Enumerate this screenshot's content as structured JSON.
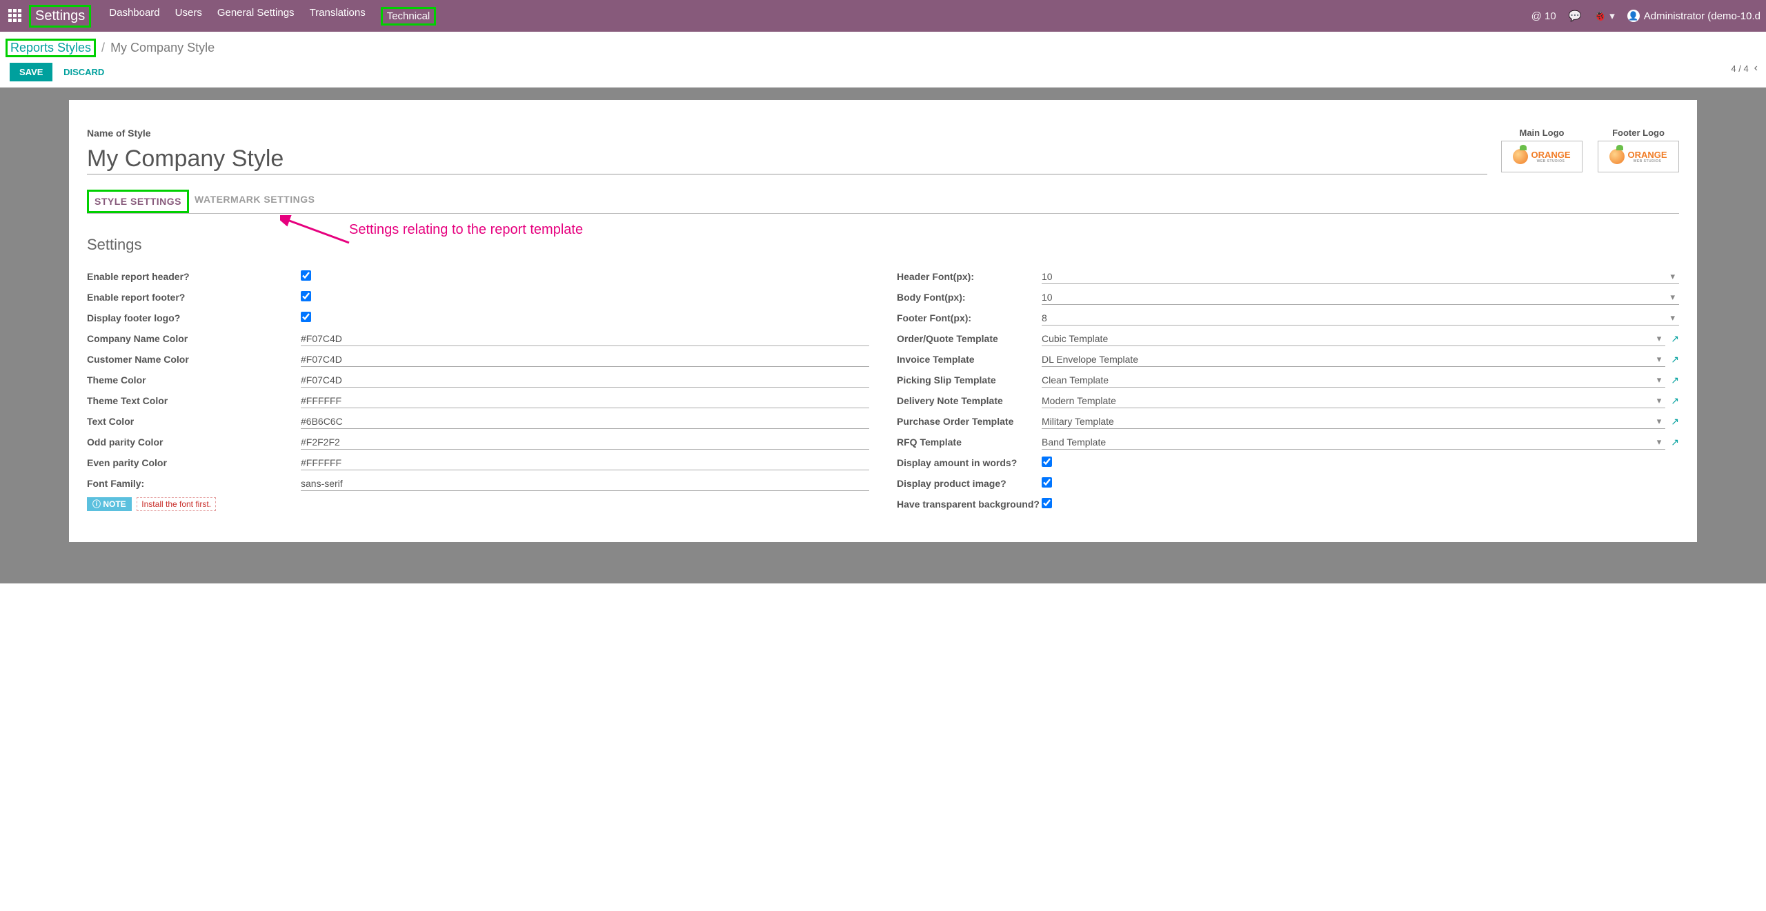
{
  "nav": {
    "brand": "Settings",
    "links": [
      "Dashboard",
      "Users",
      "General Settings",
      "Translations",
      "Technical"
    ],
    "msgCount": "@ 10",
    "user": "Administrator (demo-10.d"
  },
  "breadcrumb": {
    "root": "Reports Styles",
    "current": "My Company Style"
  },
  "buttons": {
    "save": "SAVE",
    "discard": "DISCARD"
  },
  "pager": {
    "text": "4 / 4"
  },
  "form": {
    "nameLabel": "Name of Style",
    "nameValue": "My Company Style",
    "logos": {
      "main": "Main Logo",
      "footer": "Footer Logo",
      "brand": "ORANGE",
      "brandSub": "WEB STUDIOS"
    },
    "tabs": {
      "style": "STYLE SETTINGS",
      "watermark": "WATERMARK SETTINGS"
    },
    "annotation": "Settings relating to the report template",
    "sectionTitle": "Settings",
    "left": {
      "enableHeader": "Enable report header?",
      "enableFooter": "Enable report footer?",
      "displayFooterLogo": "Display footer logo?",
      "companyNameColor": {
        "label": "Company Name Color",
        "value": "#F07C4D"
      },
      "customerNameColor": {
        "label": "Customer Name Color",
        "value": "#F07C4D"
      },
      "themeColor": {
        "label": "Theme Color",
        "value": "#F07C4D"
      },
      "themeTextColor": {
        "label": "Theme Text Color",
        "value": "#FFFFFF"
      },
      "textColor": {
        "label": "Text Color",
        "value": "#6B6C6C"
      },
      "oddParity": {
        "label": "Odd parity Color",
        "value": "#F2F2F2"
      },
      "evenParity": {
        "label": "Even parity Color",
        "value": "#FFFFFF"
      },
      "fontFamily": {
        "label": "Font Family:",
        "value": "sans-serif"
      },
      "noteBadge": "ⓘ NOTE",
      "noteText": "Install the font first."
    },
    "right": {
      "headerFont": {
        "label": "Header Font(px):",
        "value": "10"
      },
      "bodyFont": {
        "label": "Body Font(px):",
        "value": "10"
      },
      "footerFont": {
        "label": "Footer Font(px):",
        "value": "8"
      },
      "orderTpl": {
        "label": "Order/Quote Template",
        "value": "Cubic Template"
      },
      "invoiceTpl": {
        "label": "Invoice Template",
        "value": "DL Envelope Template"
      },
      "pickingTpl": {
        "label": "Picking Slip Template",
        "value": "Clean Template"
      },
      "deliveryTpl": {
        "label": "Delivery Note Template",
        "value": "Modern Template"
      },
      "poTpl": {
        "label": "Purchase Order Template",
        "value": "Military Template"
      },
      "rfqTpl": {
        "label": "RFQ Template",
        "value": "Band Template"
      },
      "amountWords": "Display amount in words?",
      "productImage": "Display product image?",
      "transparentBg": "Have transparent background?"
    }
  }
}
